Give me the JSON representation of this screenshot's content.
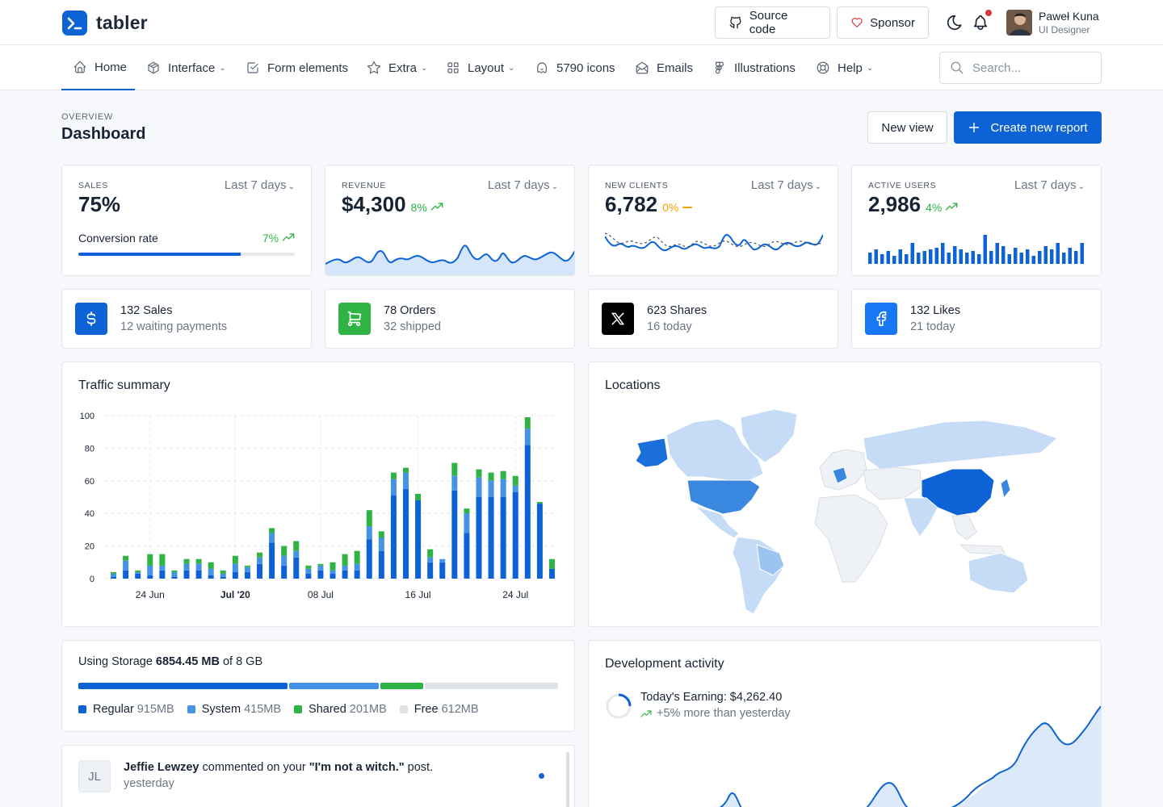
{
  "brand": {
    "name": "tabler"
  },
  "header": {
    "source_label": "Source code",
    "sponsor_label": "Sponsor",
    "user_name": "Paweł Kuna",
    "user_role": "UI Designer"
  },
  "nav": {
    "items": [
      {
        "label": "Home",
        "icon": "home-icon",
        "dropdown": false
      },
      {
        "label": "Interface",
        "icon": "package-icon",
        "dropdown": true
      },
      {
        "label": "Form elements",
        "icon": "checkbox-icon",
        "dropdown": false
      },
      {
        "label": "Extra",
        "icon": "star-icon",
        "dropdown": true
      },
      {
        "label": "Layout",
        "icon": "layout-grid-icon",
        "dropdown": true
      },
      {
        "label": "5790 icons",
        "icon": "ghost-icon",
        "dropdown": false
      },
      {
        "label": "Emails",
        "icon": "mail-icon",
        "dropdown": false
      },
      {
        "label": "Illustrations",
        "icon": "brand-figma-icon",
        "dropdown": false
      },
      {
        "label": "Help",
        "icon": "lifebuoy-icon",
        "dropdown": true
      }
    ],
    "search_placeholder": "Search..."
  },
  "page": {
    "pretitle": "Overview",
    "title": "Dashboard",
    "new_view_label": "New view",
    "create_label": "Create new report"
  },
  "kpis": {
    "sales": {
      "label": "Sales",
      "period": "Last 7 days",
      "value": "75%",
      "conversion_label": "Conversion rate",
      "conversion_change": "7%",
      "progress": 0.75
    },
    "revenue": {
      "label": "Revenue",
      "period": "Last 7 days",
      "value": "$4,300",
      "change": "8%"
    },
    "new_clients": {
      "label": "New clients",
      "period": "Last 7 days",
      "value": "6,782",
      "change": "0%"
    },
    "active_users": {
      "label": "Active users",
      "period": "Last 7 days",
      "value": "2,986",
      "change": "4%"
    }
  },
  "stats": [
    {
      "title": "132 Sales",
      "subtitle": "12 waiting payments",
      "icon": "currency-dollar-icon",
      "color": "#0d63d5"
    },
    {
      "title": "78 Orders",
      "subtitle": "32 shipped",
      "icon": "shopping-cart-icon",
      "color": "#2fb344"
    },
    {
      "title": "623 Shares",
      "subtitle": "16 today",
      "icon": "brand-x-icon",
      "color": "#000000"
    },
    {
      "title": "132 Likes",
      "subtitle": "21 today",
      "icon": "brand-facebook-icon",
      "color": "#1877f2"
    }
  ],
  "traffic": {
    "title": "Traffic summary"
  },
  "chart_data": {
    "type": "bar",
    "stacked": true,
    "ylim": [
      0,
      100
    ],
    "yticks": [
      0,
      20,
      40,
      60,
      80,
      100
    ],
    "xtick_labels": [
      {
        "index": 3,
        "label": "24 Jun",
        "bold": false
      },
      {
        "index": 10,
        "label": "Jul '20",
        "bold": true
      },
      {
        "index": 17,
        "label": "08 Jul",
        "bold": false
      },
      {
        "index": 25,
        "label": "16 Jul",
        "bold": false
      },
      {
        "index": 33,
        "label": "24 Jul",
        "bold": false
      }
    ],
    "grid": true,
    "series": [
      {
        "color": "#0d63d5",
        "values": [
          1,
          5,
          3,
          2,
          5,
          1,
          5,
          5,
          2,
          1,
          4,
          4,
          9,
          22,
          8,
          13,
          3,
          5,
          3,
          5,
          5,
          24,
          17,
          51,
          55,
          48,
          10,
          10,
          54,
          28,
          50,
          50,
          50,
          53,
          82,
          46,
          6
        ]
      },
      {
        "color": "#4592e6",
        "values": [
          2,
          6,
          1,
          6,
          3,
          3,
          4,
          4,
          4,
          2,
          5,
          3,
          4,
          6,
          6,
          4,
          3,
          3,
          2,
          3,
          4,
          8,
          8,
          10,
          10,
          0,
          3,
          2,
          9,
          12,
          12,
          10,
          11,
          4,
          10,
          0,
          0
        ]
      },
      {
        "color": "#2fb344",
        "values": [
          1,
          3,
          1,
          7,
          7,
          1,
          3,
          3,
          4,
          2,
          5,
          1,
          3,
          3,
          6,
          6,
          2,
          1,
          5,
          7,
          8,
          10,
          4,
          4,
          3,
          4,
          5,
          0,
          8,
          3,
          5,
          5,
          5,
          6,
          7,
          1,
          6
        ]
      }
    ]
  },
  "locations": {
    "title": "Locations"
  },
  "storage": {
    "title_prefix": "Using Storage",
    "used": "6854.45 MB",
    "of_text": "of 8 GB",
    "segments": [
      {
        "label": "Regular",
        "size": "915MB",
        "color": "#0d63d5",
        "fraction": 0.44
      },
      {
        "label": "System",
        "size": "415MB",
        "color": "#4592e6",
        "fraction": 0.19
      },
      {
        "label": "Shared",
        "size": "201MB",
        "color": "#2fb344",
        "fraction": 0.09
      },
      {
        "label": "Free",
        "size": "612MB",
        "color": "#dfe3e8",
        "fraction": 0.28
      }
    ]
  },
  "comment": {
    "initials": "JL",
    "author": "Jeffie Lewzey",
    "text_middle": "commented on your",
    "post": "\"I'm not a witch.\"",
    "text_end": "post.",
    "time": "yesterday"
  },
  "dev": {
    "title": "Development activity",
    "earning": "Today's Earning: $4,262.40",
    "earning_change": "+5% more than yesterday"
  }
}
